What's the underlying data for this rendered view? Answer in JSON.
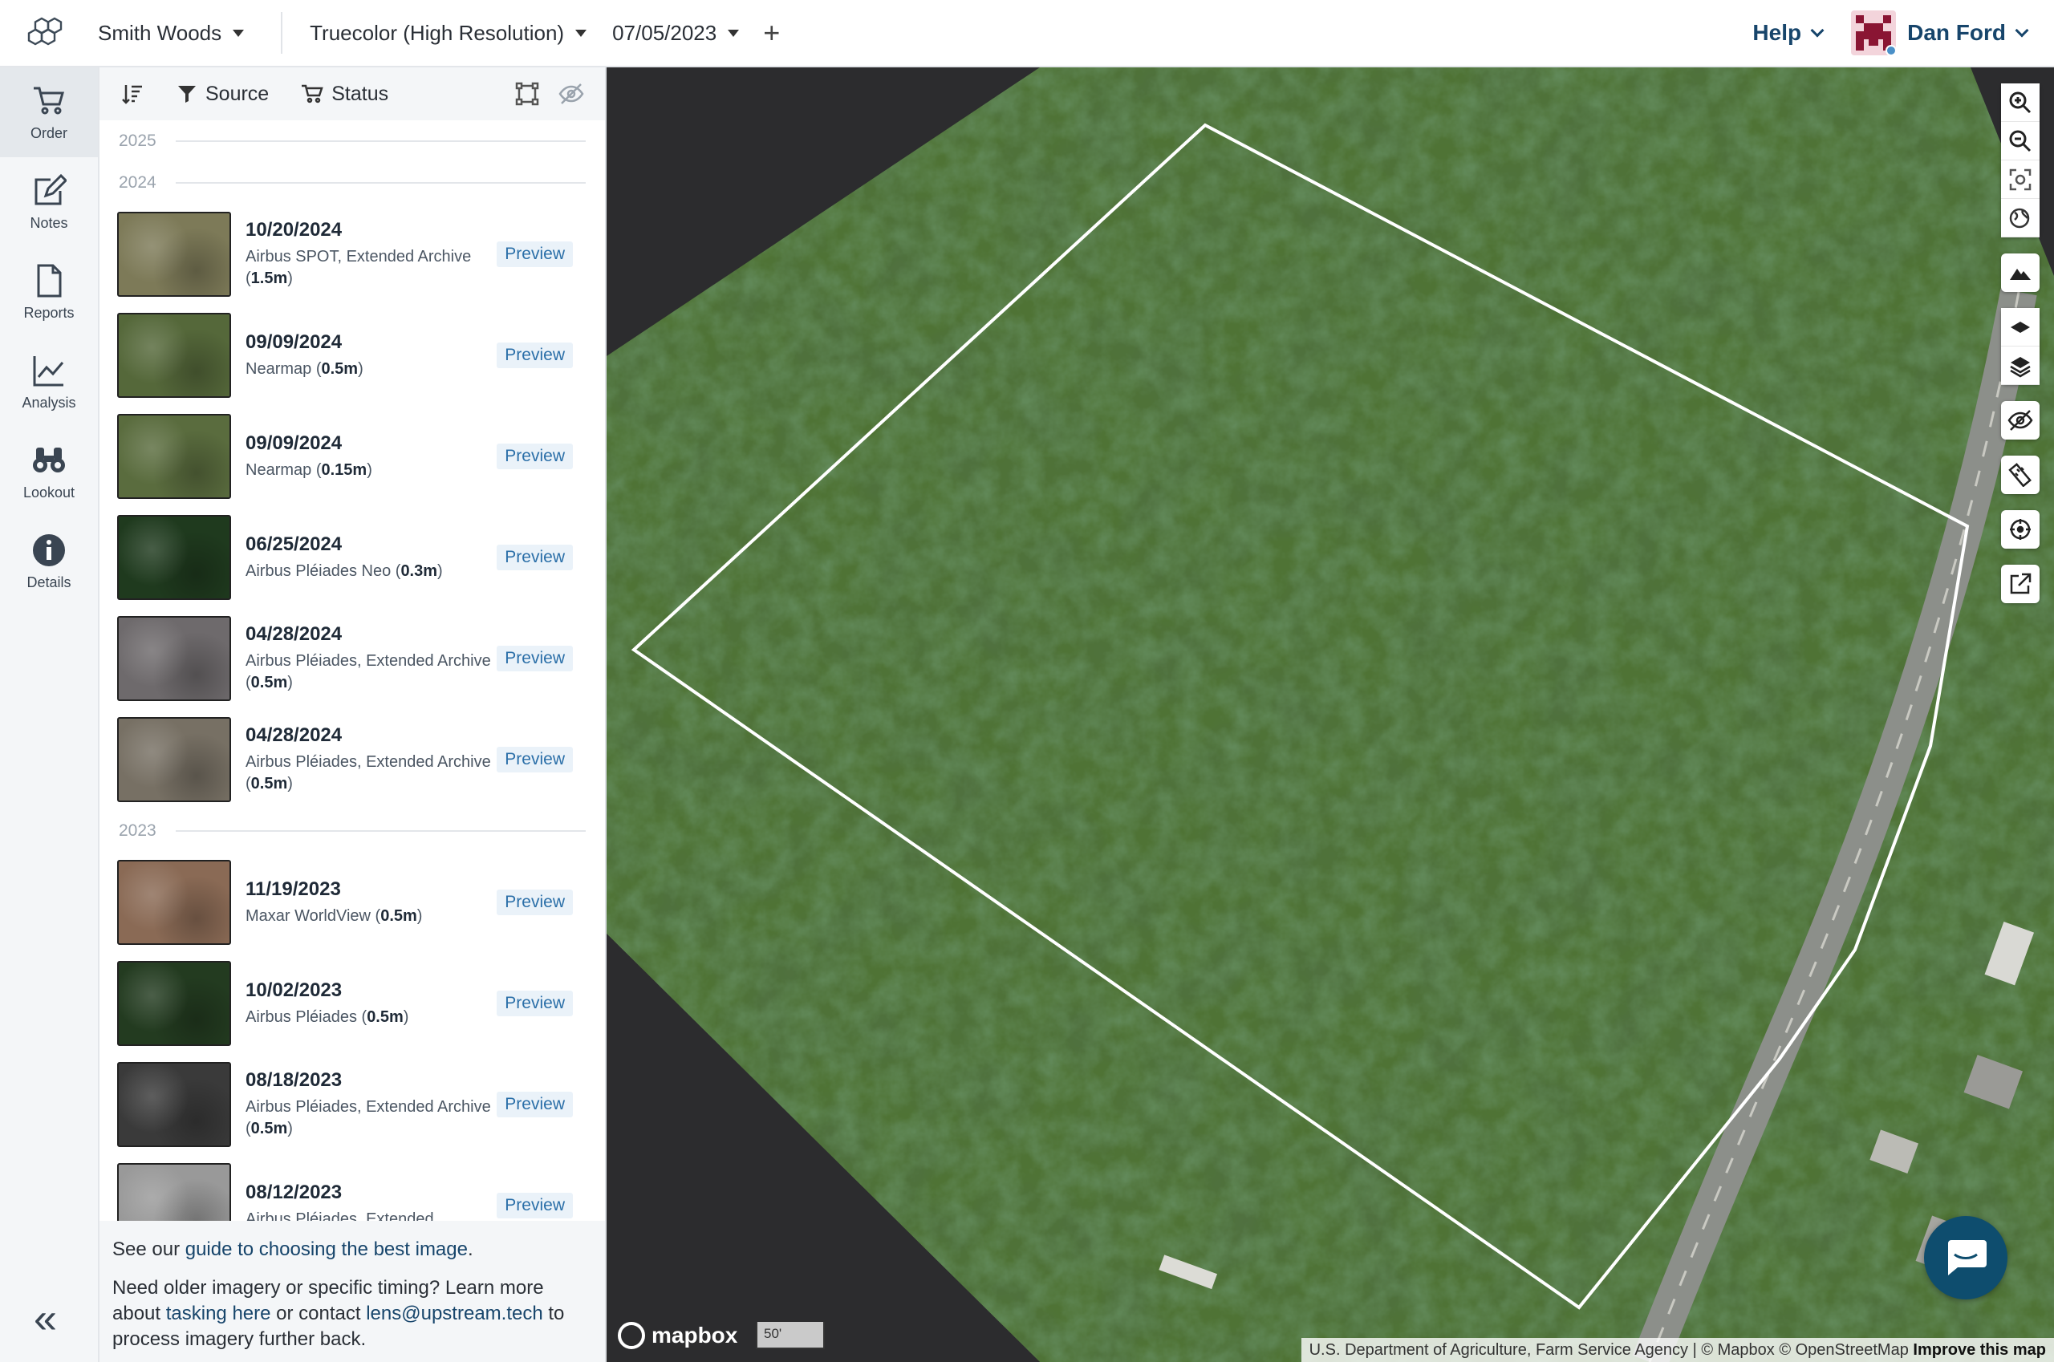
{
  "topbar": {
    "property": "Smith Woods",
    "layer": "Truecolor (High Resolution)",
    "date": "07/05/2023",
    "add_label": "+",
    "help_label": "Help",
    "user_name": "Dan Ford"
  },
  "nav": [
    {
      "label": "Order",
      "icon": "cart-icon"
    },
    {
      "label": "Notes",
      "icon": "notes-icon"
    },
    {
      "label": "Reports",
      "icon": "document-icon"
    },
    {
      "label": "Analysis",
      "icon": "chart-line-icon"
    },
    {
      "label": "Lookout",
      "icon": "binoculars-icon"
    },
    {
      "label": "Details",
      "icon": "info-icon"
    }
  ],
  "collapse_label": "«",
  "panel_toolbar": {
    "source_label": "Source",
    "status_label": "Status"
  },
  "years": {
    "y2025": "2025",
    "y2024": "2024",
    "y2023": "2023"
  },
  "preview_label": "Preview",
  "imagery_2024": [
    {
      "date": "10/20/2024",
      "source": "Airbus SPOT, Extended Archive",
      "res": "1.5m",
      "thumb": "#7d7a58"
    },
    {
      "date": "09/09/2024",
      "source": "Nearmap",
      "res": "0.5m",
      "thumb": "#55683a"
    },
    {
      "date": "09/09/2024",
      "source": "Nearmap",
      "res": "0.15m",
      "thumb": "#5a6c3e"
    },
    {
      "date": "06/25/2024",
      "source": "Airbus Pléiades Neo",
      "res": "0.3m",
      "thumb": "#1f3a1e"
    },
    {
      "date": "04/28/2024",
      "source": "Airbus Pléiades, Extended Archive",
      "res": "0.5m",
      "thumb": "#6e6a6c"
    },
    {
      "date": "04/28/2024",
      "source": "Airbus Pléiades, Extended Archive",
      "res": "0.5m",
      "thumb": "#777064"
    }
  ],
  "imagery_2023": [
    {
      "date": "11/19/2023",
      "source": "Maxar WorldView",
      "res": "0.5m",
      "thumb": "#8a6a55"
    },
    {
      "date": "10/02/2023",
      "source": "Airbus Pléiades",
      "res": "0.5m",
      "thumb": "#233b20"
    },
    {
      "date": "08/18/2023",
      "source": "Airbus Pléiades, Extended Archive",
      "res": "0.5m",
      "thumb": "#3a3a3a"
    },
    {
      "date": "08/12/2023",
      "source": "Airbus Pléiades, Extended",
      "res": "",
      "thumb": "#999999"
    }
  ],
  "footer": {
    "guide_pre": "See our ",
    "guide_link": "guide to choosing the best image",
    "guide_post": ".",
    "older_pre": "Need older imagery or specific timing? Learn more about ",
    "tasking_link": "tasking here",
    "older_mid": " or contact ",
    "email_link": "lens@upstream.tech",
    "older_post": " to process imagery further back."
  },
  "map": {
    "mapbox_label": "mapbox",
    "scale_label": "50'",
    "attribution": "U.S. Department of Agriculture, Farm Service Agency | © Mapbox © OpenStreetMap",
    "improve_label": "Improve this map"
  },
  "colors": {
    "accent": "#17456b",
    "link": "#2b6fa8",
    "chat": "#0e4d6e"
  }
}
